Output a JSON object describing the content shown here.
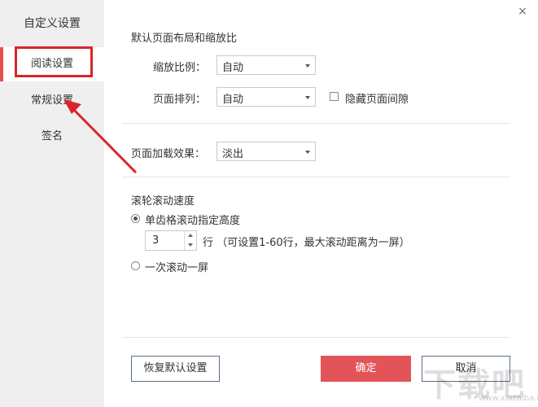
{
  "sidebar": {
    "title": "自定义设置",
    "items": [
      {
        "label": "阅读设置",
        "active": true
      },
      {
        "label": "常规设置",
        "active": false
      },
      {
        "label": "签名",
        "active": false
      }
    ]
  },
  "close_glyph": "×",
  "layout_section": {
    "title": "默认页面布局和缩放比",
    "zoom_label": "缩放比例：",
    "zoom_value": "自动",
    "arrange_label": "页面排列：",
    "arrange_value": "自动",
    "hide_gap_label": "隐藏页面间隙",
    "hide_gap_checked": false
  },
  "load_section": {
    "effect_label": "页面加载效果：",
    "effect_value": "淡出"
  },
  "scroll_section": {
    "title": "滚轮滚动速度",
    "option_single": "单齿格滚动指定高度",
    "option_single_checked": true,
    "rows_value": "3",
    "rows_hint": "行 （可设置1-60行，最大滚动距离为一屏）",
    "option_screen": "一次滚动一屏",
    "option_screen_checked": false
  },
  "buttons": {
    "reset": "恢复默认设置",
    "ok": "确定",
    "cancel": "取消"
  },
  "annotation": {
    "highlight_color": "#d9252a"
  },
  "colors": {
    "accent": "#e35459",
    "sidebar_bg": "#efefef"
  }
}
